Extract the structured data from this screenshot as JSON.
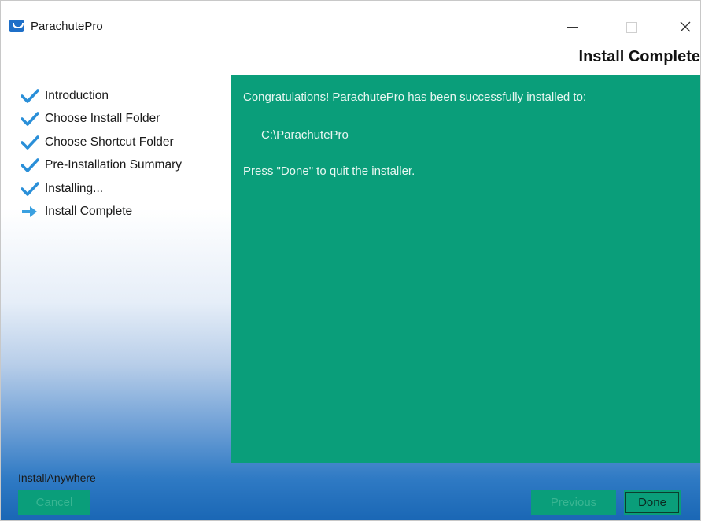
{
  "window": {
    "title": "ParachutePro",
    "controls": {
      "minimize": "minimize",
      "maximize": "maximize",
      "close": "close"
    }
  },
  "header": {
    "title": "Install Complete"
  },
  "steps": [
    {
      "label": "Introduction",
      "status": "done",
      "icon": "checkmark-icon"
    },
    {
      "label": "Choose Install Folder",
      "status": "done",
      "icon": "checkmark-icon"
    },
    {
      "label": "Choose Shortcut Folder",
      "status": "done",
      "icon": "checkmark-icon"
    },
    {
      "label": "Pre-Installation Summary",
      "status": "done",
      "icon": "checkmark-icon"
    },
    {
      "label": "Installing...",
      "status": "done",
      "icon": "checkmark-icon"
    },
    {
      "label": "Install Complete",
      "status": "current",
      "icon": "arrow-right-icon"
    }
  ],
  "content": {
    "line1": "Congratulations! ParachutePro has been successfully installed to:",
    "install_path": "C:\\ParachutePro",
    "line3": "Press \"Done\" to quit the installer."
  },
  "footer": {
    "brand": "InstallAnywhere",
    "cancel_label": "Cancel",
    "previous_label": "Previous",
    "done_label": "Done"
  },
  "colors": {
    "content_bg": "#0a9e7a",
    "check": "#2a8fd8",
    "arrow": "#3aa0e0"
  }
}
